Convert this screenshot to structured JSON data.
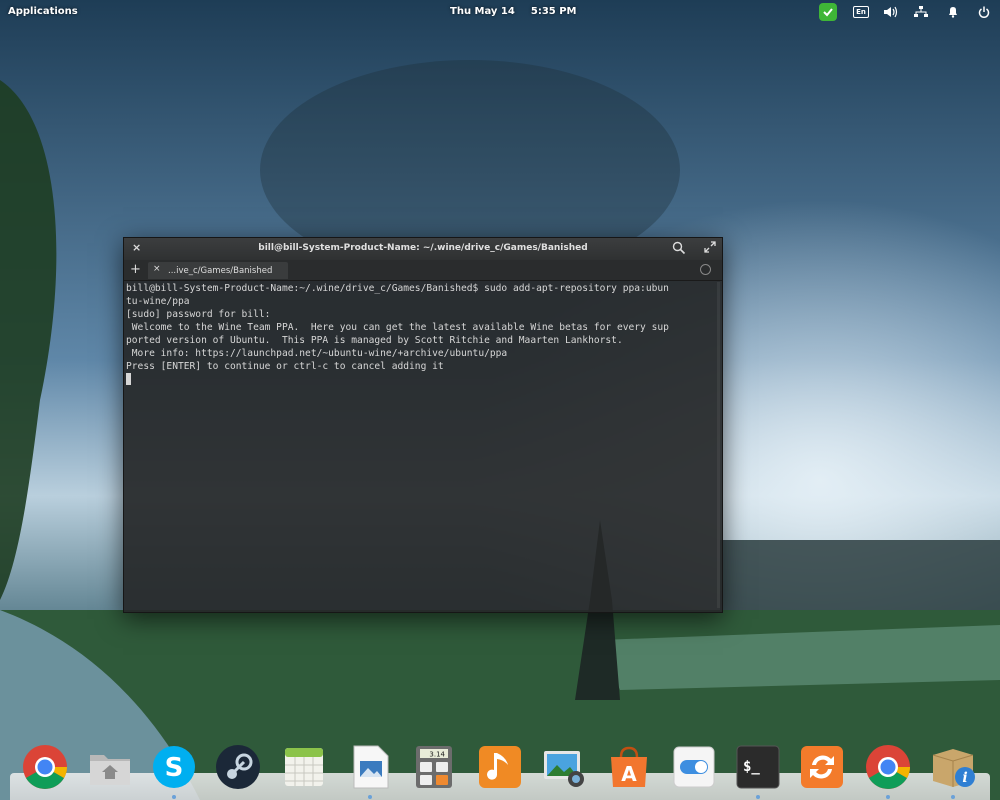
{
  "top_panel": {
    "applications_label": "Applications",
    "date": "Thu May 14",
    "time": "5:35 PM",
    "indicators": [
      {
        "name": "update-check-icon",
        "color": "#3fb637"
      },
      {
        "name": "keyboard-layout",
        "label": "En"
      },
      {
        "name": "volume-icon"
      },
      {
        "name": "network-icon"
      },
      {
        "name": "notifications-bell-icon"
      },
      {
        "name": "power-icon"
      }
    ]
  },
  "terminal": {
    "title": "bill@bill-System-Product-Name: ~/.wine/drive_c/Games/Banished",
    "tab_label": "...ive_c/Games/Banished",
    "lines": [
      "bill@bill-System-Product-Name:~/.wine/drive_c/Games/Banished$ sudo add-apt-repository ppa:ubun",
      "tu-wine/ppa",
      "[sudo] password for bill:",
      " Welcome to the Wine Team PPA.  Here you can get the latest available Wine betas for every sup",
      "ported version of Ubuntu.  This PPA is managed by Scott Ritchie and Maarten Lankhorst.",
      " More info: https://launchpad.net/~ubuntu-wine/+archive/ubuntu/ppa",
      "Press [ENTER] to continue or ctrl-c to cancel adding it"
    ]
  },
  "dock": {
    "items": [
      {
        "name": "chrome-icon",
        "running": false
      },
      {
        "name": "files-icon",
        "running": false
      },
      {
        "name": "skype-icon",
        "running": true
      },
      {
        "name": "steam-icon",
        "running": false
      },
      {
        "name": "calendar-icon",
        "running": false
      },
      {
        "name": "document-viewer-icon",
        "running": true
      },
      {
        "name": "calculator-icon",
        "running": false,
        "label": "3.14"
      },
      {
        "name": "music-icon",
        "running": false
      },
      {
        "name": "photos-icon",
        "running": false
      },
      {
        "name": "software-center-icon",
        "running": false
      },
      {
        "name": "switchboard-settings-icon",
        "running": false
      },
      {
        "name": "terminal-icon",
        "running": true,
        "label": "$_"
      },
      {
        "name": "update-manager-icon",
        "running": false
      },
      {
        "name": "chrome-icon-2",
        "running": true
      },
      {
        "name": "package-info-icon",
        "running": true
      }
    ]
  }
}
